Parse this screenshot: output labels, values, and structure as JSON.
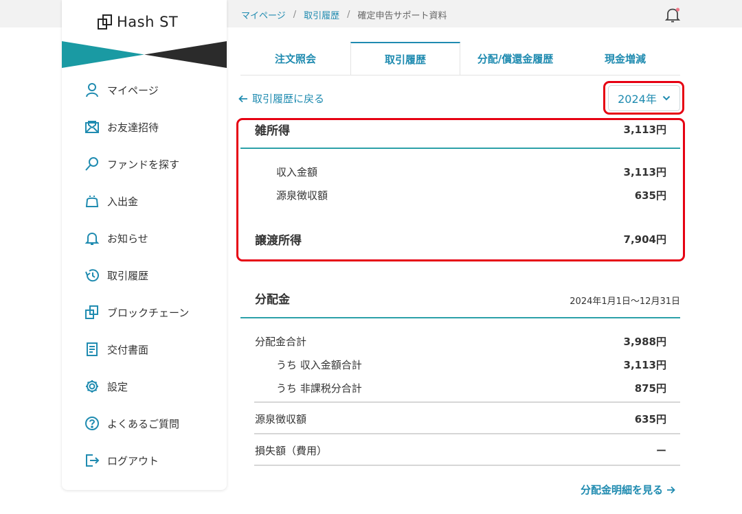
{
  "app": {
    "logo_text": "Hash ST"
  },
  "breadcrumb": {
    "items": [
      "マイページ",
      "取引履歴"
    ],
    "current": "確定申告サポート資料",
    "separator": "/"
  },
  "sidebar": {
    "items": [
      {
        "label": "マイページ",
        "icon": "user-icon"
      },
      {
        "label": "お友達招待",
        "icon": "mail-invite-icon"
      },
      {
        "label": "ファンドを探す",
        "icon": "search-icon"
      },
      {
        "label": "入出金",
        "icon": "wallet-icon"
      },
      {
        "label": "お知らせ",
        "icon": "bell-icon"
      },
      {
        "label": "取引履歴",
        "icon": "history-icon"
      },
      {
        "label": "ブロックチェーン",
        "icon": "blockchain-icon"
      },
      {
        "label": "交付書面",
        "icon": "document-icon"
      },
      {
        "label": "設定",
        "icon": "gear-icon"
      },
      {
        "label": "よくあるご質問",
        "icon": "question-icon"
      },
      {
        "label": "ログアウト",
        "icon": "logout-icon"
      }
    ]
  },
  "tabs": [
    {
      "label": "注文照会",
      "active": false
    },
    {
      "label": "取引履歴",
      "active": true
    },
    {
      "label": "分配/償還金履歴",
      "active": false
    },
    {
      "label": "現金増減",
      "active": false
    }
  ],
  "back_link": "取引履歴に戻る",
  "year_select": {
    "value": "2024年"
  },
  "income": {
    "misc": {
      "label": "雑所得",
      "value": "3,113円"
    },
    "revenue": {
      "label": "収入金額",
      "value": "3,113円"
    },
    "withholding": {
      "label": "源泉徴収額",
      "value": "635円"
    },
    "transfer": {
      "label": "譲渡所得",
      "value": "7,904円"
    }
  },
  "distribution": {
    "title": "分配金",
    "period": "2024年1月1日〜12月31日",
    "total": {
      "label": "分配金合計",
      "value": "3,988円"
    },
    "revenue_total": {
      "label": "うち 収入金額合計",
      "value": "3,113円"
    },
    "nontaxable_total": {
      "label": "うち 非課税分合計",
      "value": "875円"
    },
    "withholding": {
      "label": "源泉徴収額",
      "value": "635円"
    },
    "loss": {
      "label": "損失額（費用）",
      "value": "ー"
    },
    "detail_link": "分配金明細を見る"
  },
  "colors": {
    "accent": "#1f8bb0",
    "teal": "#2aa0a8",
    "highlight": "#e60012"
  }
}
